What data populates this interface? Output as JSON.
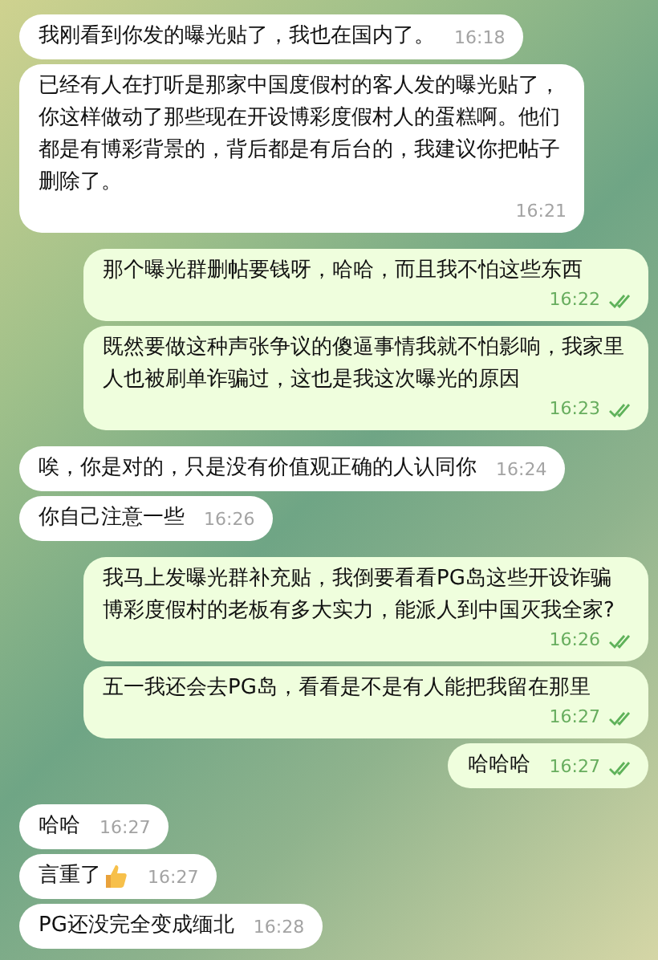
{
  "messages": [
    {
      "text": "我刚看到你发的曝光贴了，我也在国内了。",
      "time": "16:18",
      "outgoing": false
    },
    {
      "text": "已经有人在打听是那家中国度假村的客人发的曝光贴了，你这样做动了那些现在开设博彩度假村人的蛋糕啊。他们都是有博彩背景的，背后都是有后台的，我建议你把帖子删除了。",
      "time": "16:21",
      "outgoing": false
    },
    {
      "text": "那个曝光群删帖要钱呀，哈哈，而且我不怕这些东西",
      "time": "16:22",
      "outgoing": true,
      "read": true
    },
    {
      "text": "既然要做这种声张争议的傻逼事情我就不怕影响，我家里人也被刷单诈骗过，这也是我这次曝光的原因",
      "time": "16:23",
      "outgoing": true,
      "read": true
    },
    {
      "text": "唉，你是对的，只是没有价值观正确的人认同你",
      "time": "16:24",
      "outgoing": false
    },
    {
      "text": "你自己注意一些",
      "time": "16:26",
      "outgoing": false
    },
    {
      "text": "我马上发曝光群补充贴，我倒要看看PG岛这些开设诈骗博彩度假村的老板有多大实力，能派人到中国灭我全家?",
      "time": "16:26",
      "outgoing": true,
      "read": true
    },
    {
      "text": "五一我还会去PG岛，看看是不是有人能把我留在那里",
      "time": "16:27",
      "outgoing": true,
      "read": true
    },
    {
      "text": "哈哈哈",
      "time": "16:27",
      "outgoing": true,
      "read": true
    },
    {
      "text": "哈哈",
      "time": "16:27",
      "outgoing": false
    },
    {
      "text": "言重了",
      "time": "16:27",
      "outgoing": false,
      "thumbs_up": true
    },
    {
      "text": "PG还没完全变成缅北",
      "time": "16:28",
      "outgoing": false
    }
  ]
}
